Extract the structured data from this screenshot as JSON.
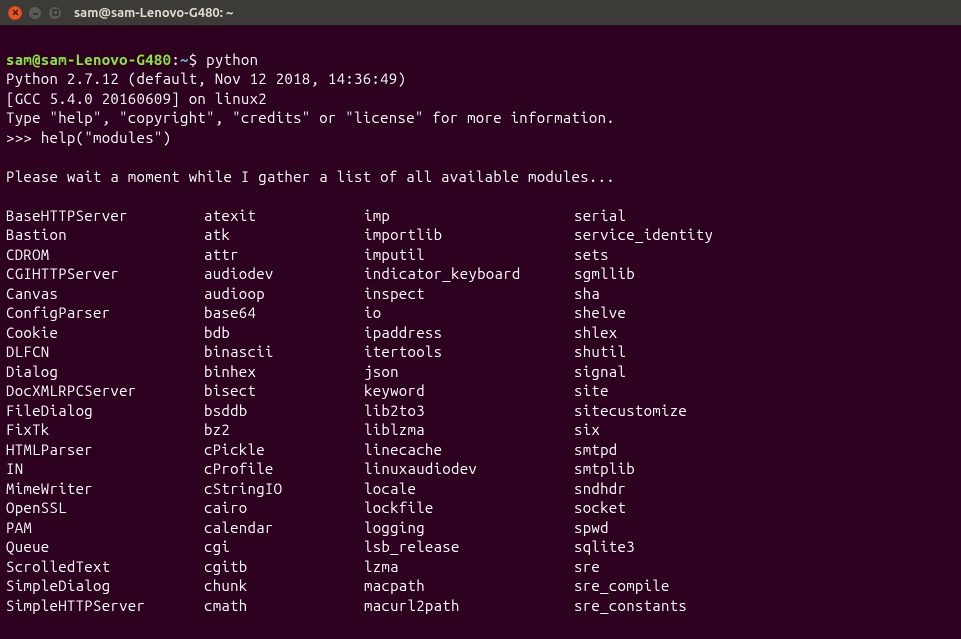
{
  "window": {
    "title": "sam@sam-Lenovo-G480: ~"
  },
  "prompt": {
    "user_host": "sam@sam-Lenovo-G480",
    "sep1": ":",
    "path": "~",
    "sep2": "$ ",
    "command": "python"
  },
  "python_header": {
    "line1": "Python 2.7.12 (default, Nov 12 2018, 14:36:49)",
    "line2": "[GCC 5.4.0 20160609] on linux2",
    "line3": "Type \"help\", \"copyright\", \"credits\" or \"license\" for more information."
  },
  "repl": {
    "prompt": ">>> ",
    "input": "help(\"modules\")"
  },
  "wait_msg": "Please wait a moment while I gather a list of all available modules...",
  "modules": [
    [
      "BaseHTTPServer",
      "atexit",
      "imp",
      "serial"
    ],
    [
      "Bastion",
      "atk",
      "importlib",
      "service_identity"
    ],
    [
      "CDROM",
      "attr",
      "imputil",
      "sets"
    ],
    [
      "CGIHTTPServer",
      "audiodev",
      "indicator_keyboard",
      "sgmllib"
    ],
    [
      "Canvas",
      "audioop",
      "inspect",
      "sha"
    ],
    [
      "ConfigParser",
      "base64",
      "io",
      "shelve"
    ],
    [
      "Cookie",
      "bdb",
      "ipaddress",
      "shlex"
    ],
    [
      "DLFCN",
      "binascii",
      "itertools",
      "shutil"
    ],
    [
      "Dialog",
      "binhex",
      "json",
      "signal"
    ],
    [
      "DocXMLRPCServer",
      "bisect",
      "keyword",
      "site"
    ],
    [
      "FileDialog",
      "bsddb",
      "lib2to3",
      "sitecustomize"
    ],
    [
      "FixTk",
      "bz2",
      "liblzma",
      "six"
    ],
    [
      "HTMLParser",
      "cPickle",
      "linecache",
      "smtpd"
    ],
    [
      "IN",
      "cProfile",
      "linuxaudiodev",
      "smtplib"
    ],
    [
      "MimeWriter",
      "cStringIO",
      "locale",
      "sndhdr"
    ],
    [
      "OpenSSL",
      "cairo",
      "lockfile",
      "socket"
    ],
    [
      "PAM",
      "calendar",
      "logging",
      "spwd"
    ],
    [
      "Queue",
      "cgi",
      "lsb_release",
      "sqlite3"
    ],
    [
      "ScrolledText",
      "cgitb",
      "lzma",
      "sre"
    ],
    [
      "SimpleDialog",
      "chunk",
      "macpath",
      "sre_compile"
    ],
    [
      "SimpleHTTPServer",
      "cmath",
      "macurl2path",
      "sre_constants"
    ]
  ]
}
